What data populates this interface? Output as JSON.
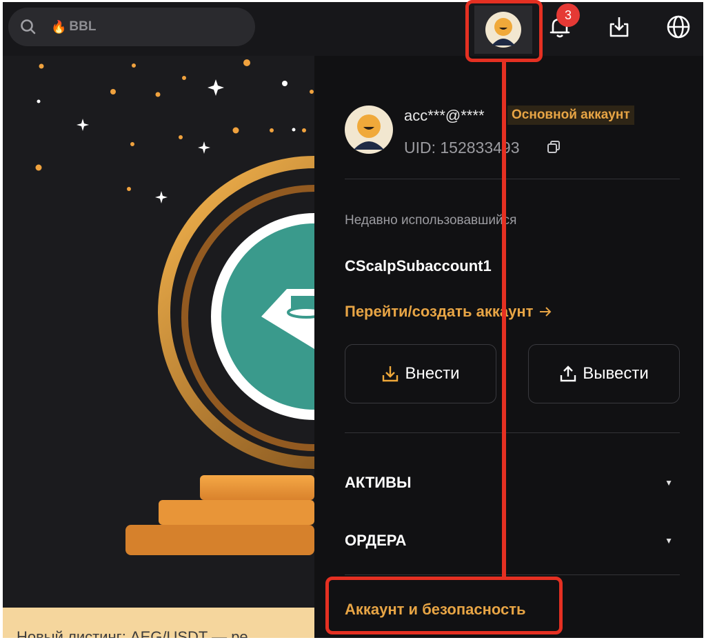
{
  "topbar": {
    "search": {
      "hot_label": "BBL"
    },
    "notifications": {
      "count": "3"
    }
  },
  "account": {
    "email": "acc***@****",
    "tag": "Основной аккаунт",
    "uid": "UID: 152833493"
  },
  "recent": {
    "label": "Недавно использовавшийся",
    "subaccount": "CScalpSubaccount1",
    "switch_link": "Перейти/создать аккаунт"
  },
  "actions": {
    "deposit": "Внести",
    "withdraw": "Вывести"
  },
  "menu": {
    "assets": "АКТИВЫ",
    "orders": "ОРДЕРА",
    "security": "Аккаунт и безопасность"
  },
  "banner": {
    "text": "Новый листинг: AEG/USDT — ре"
  },
  "colors": {
    "accent": "#e8a545",
    "highlight": "#e53022",
    "badge": "#e53935"
  },
  "icons": [
    "search-icon",
    "fire-icon",
    "avatar-icon",
    "bell-icon",
    "download-icon",
    "globe-icon",
    "copy-icon",
    "deposit-icon",
    "withdraw-icon",
    "arrow-right-icon",
    "caret-down-icon"
  ]
}
